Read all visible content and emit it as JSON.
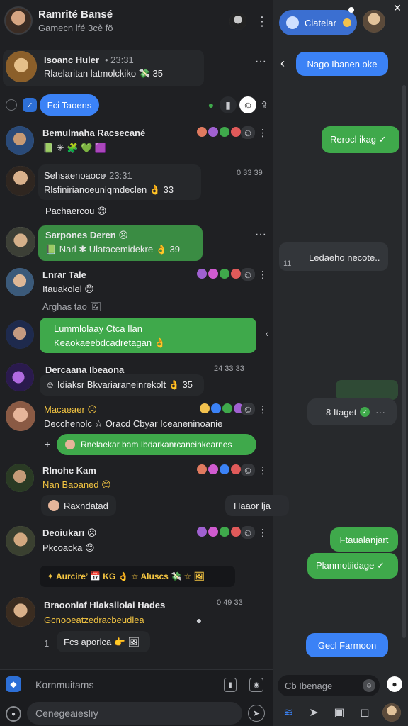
{
  "header": {
    "name": "Ramrité Bansé",
    "subtitle": "Gamecn lfé 3cè fö",
    "compose_label": "Ciatelar",
    "close_symbol": "✕"
  },
  "filter_chip": "Fci Taoens",
  "chats": [
    {
      "name": "Isoanc Huler",
      "meta": "• 23:31",
      "preview": "Rlaelaritan latmolckiko 💸 35",
      "avatar_color": "#c28a3a"
    },
    {
      "name": "Bemulmaha Racsecané",
      "meta": "",
      "preview": "📗 ✳ 🧩 💚 🟪",
      "avatar_color": "#4a7bb8"
    },
    {
      "name": "Sehsaenoaoce",
      "meta": "• 23:31",
      "preview": "Rlsfinirianoeunlqmdeclen 👌 33",
      "extra": "Pachaercou 😊",
      "avatar_color": "#6b5a48",
      "time": "0 33 39"
    },
    {
      "name": "Sarpones Deren ☹",
      "meta": "",
      "preview": "📗 Narl ✱ Ulatacemidekre 👌 39",
      "avatar_color": "#9aa08a"
    },
    {
      "name": "Lnrar Tale",
      "meta": "",
      "preview": "Itauakolel 😊",
      "extra": "Arghas tao 🖼",
      "avatar_color": "#4d6f91"
    },
    {
      "name": "Lummlolaay Ctca Ilan",
      "meta": "",
      "preview": "Keaokaeebdcadretagan 👌",
      "avatar_color": "#2c3f6b"
    },
    {
      "name": "Dercaana Ibeaona",
      "meta": "",
      "preview": "☺ Idiaksr Bkvariaraneinrekolt 👌 35",
      "avatar_color": "#5a3a8a",
      "time": "24 33 33"
    },
    {
      "name": "Macaeaer ☹",
      "meta": "",
      "preview": "Decchenolc ☆ Oracd Cbyar Iceaneninoanie",
      "reply": "Rnelaekar bam Ibdarkanrcaneinkearnes",
      "avatar_color": "#c48a70"
    },
    {
      "name": "Rlnohe Kam",
      "meta": "",
      "preview": "Nan Baoaned 😊",
      "extra": "Raxndatad",
      "extra_right": "Haaor lja",
      "avatar_color": "#4f7a46"
    },
    {
      "name": "Deoiukarı ☹",
      "meta": "",
      "preview": "Pkcoacka 😊",
      "extra": "✦ Aurcire’ 📅 KG 👌 ☆ Aluscs 💸 ☆ 🖼",
      "avatar_color": "#6f7d5a"
    },
    {
      "name": "Braoonlaf Hlaksilolai Hades",
      "meta": "",
      "preview": "Gcnooeatzedracbeudlea",
      "extra": "Fcs aporica 👉 🖼",
      "extra_num": "1",
      "avatar_color": "#8a6a4f",
      "time": "0 49 33"
    }
  ],
  "right_panel": {
    "top_bubble": "Nago Ibanen oke",
    "messages": [
      {
        "text": "Rerocl ikag ✓",
        "kind": "green"
      },
      {
        "text": "Ledaeho necote..",
        "kind": "dark",
        "num": "11"
      },
      {
        "text": "8 Itaget",
        "kind": "dark"
      },
      {
        "text": "Ftaualanjart",
        "kind": "green"
      },
      {
        "text": "Planmotiidage ✓",
        "kind": "green"
      },
      {
        "text": "Gecl Farmoon",
        "kind": "blue"
      }
    ],
    "input_placeholder": "Cb Ibenage"
  },
  "composer": {
    "channel_label": "Kornmuitams",
    "message_placeholder": "Cenegeaieslıy"
  },
  "colors": {
    "accent": "#3b82f6",
    "green": "#3fa94b",
    "bg": "#1f2023"
  }
}
